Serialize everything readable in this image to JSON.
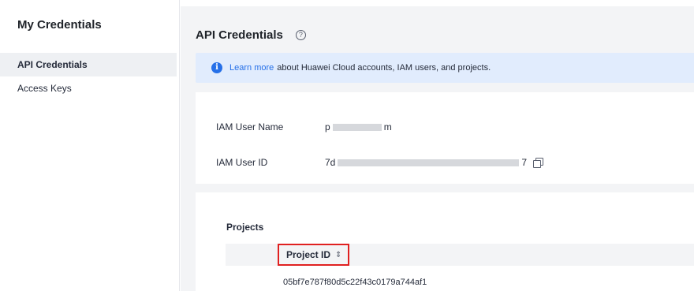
{
  "sidebar": {
    "title": "My Credentials",
    "items": [
      {
        "label": "API Credentials",
        "active": true
      },
      {
        "label": "Access Keys",
        "active": false
      }
    ]
  },
  "main": {
    "title": "API Credentials",
    "help_icon": "?",
    "info": {
      "icon": "i",
      "link": "Learn more",
      "text": "about Huawei Cloud accounts, IAM users, and projects."
    },
    "user": {
      "name_label": "IAM User Name",
      "name_prefix": "p",
      "name_suffix": "m",
      "id_label": "IAM User ID",
      "id_prefix": "7d",
      "id_suffix": "7"
    },
    "projects": {
      "title": "Projects",
      "columns": [
        "Project ID"
      ],
      "sort_icon": "⇕",
      "rows": [
        [
          "05bf7e787f80d5c22f43c0179a744af1"
        ]
      ]
    }
  },
  "colors": {
    "accent": "#2670e8",
    "highlight_border": "#e02020",
    "info_bg": "#e1ecfd"
  }
}
